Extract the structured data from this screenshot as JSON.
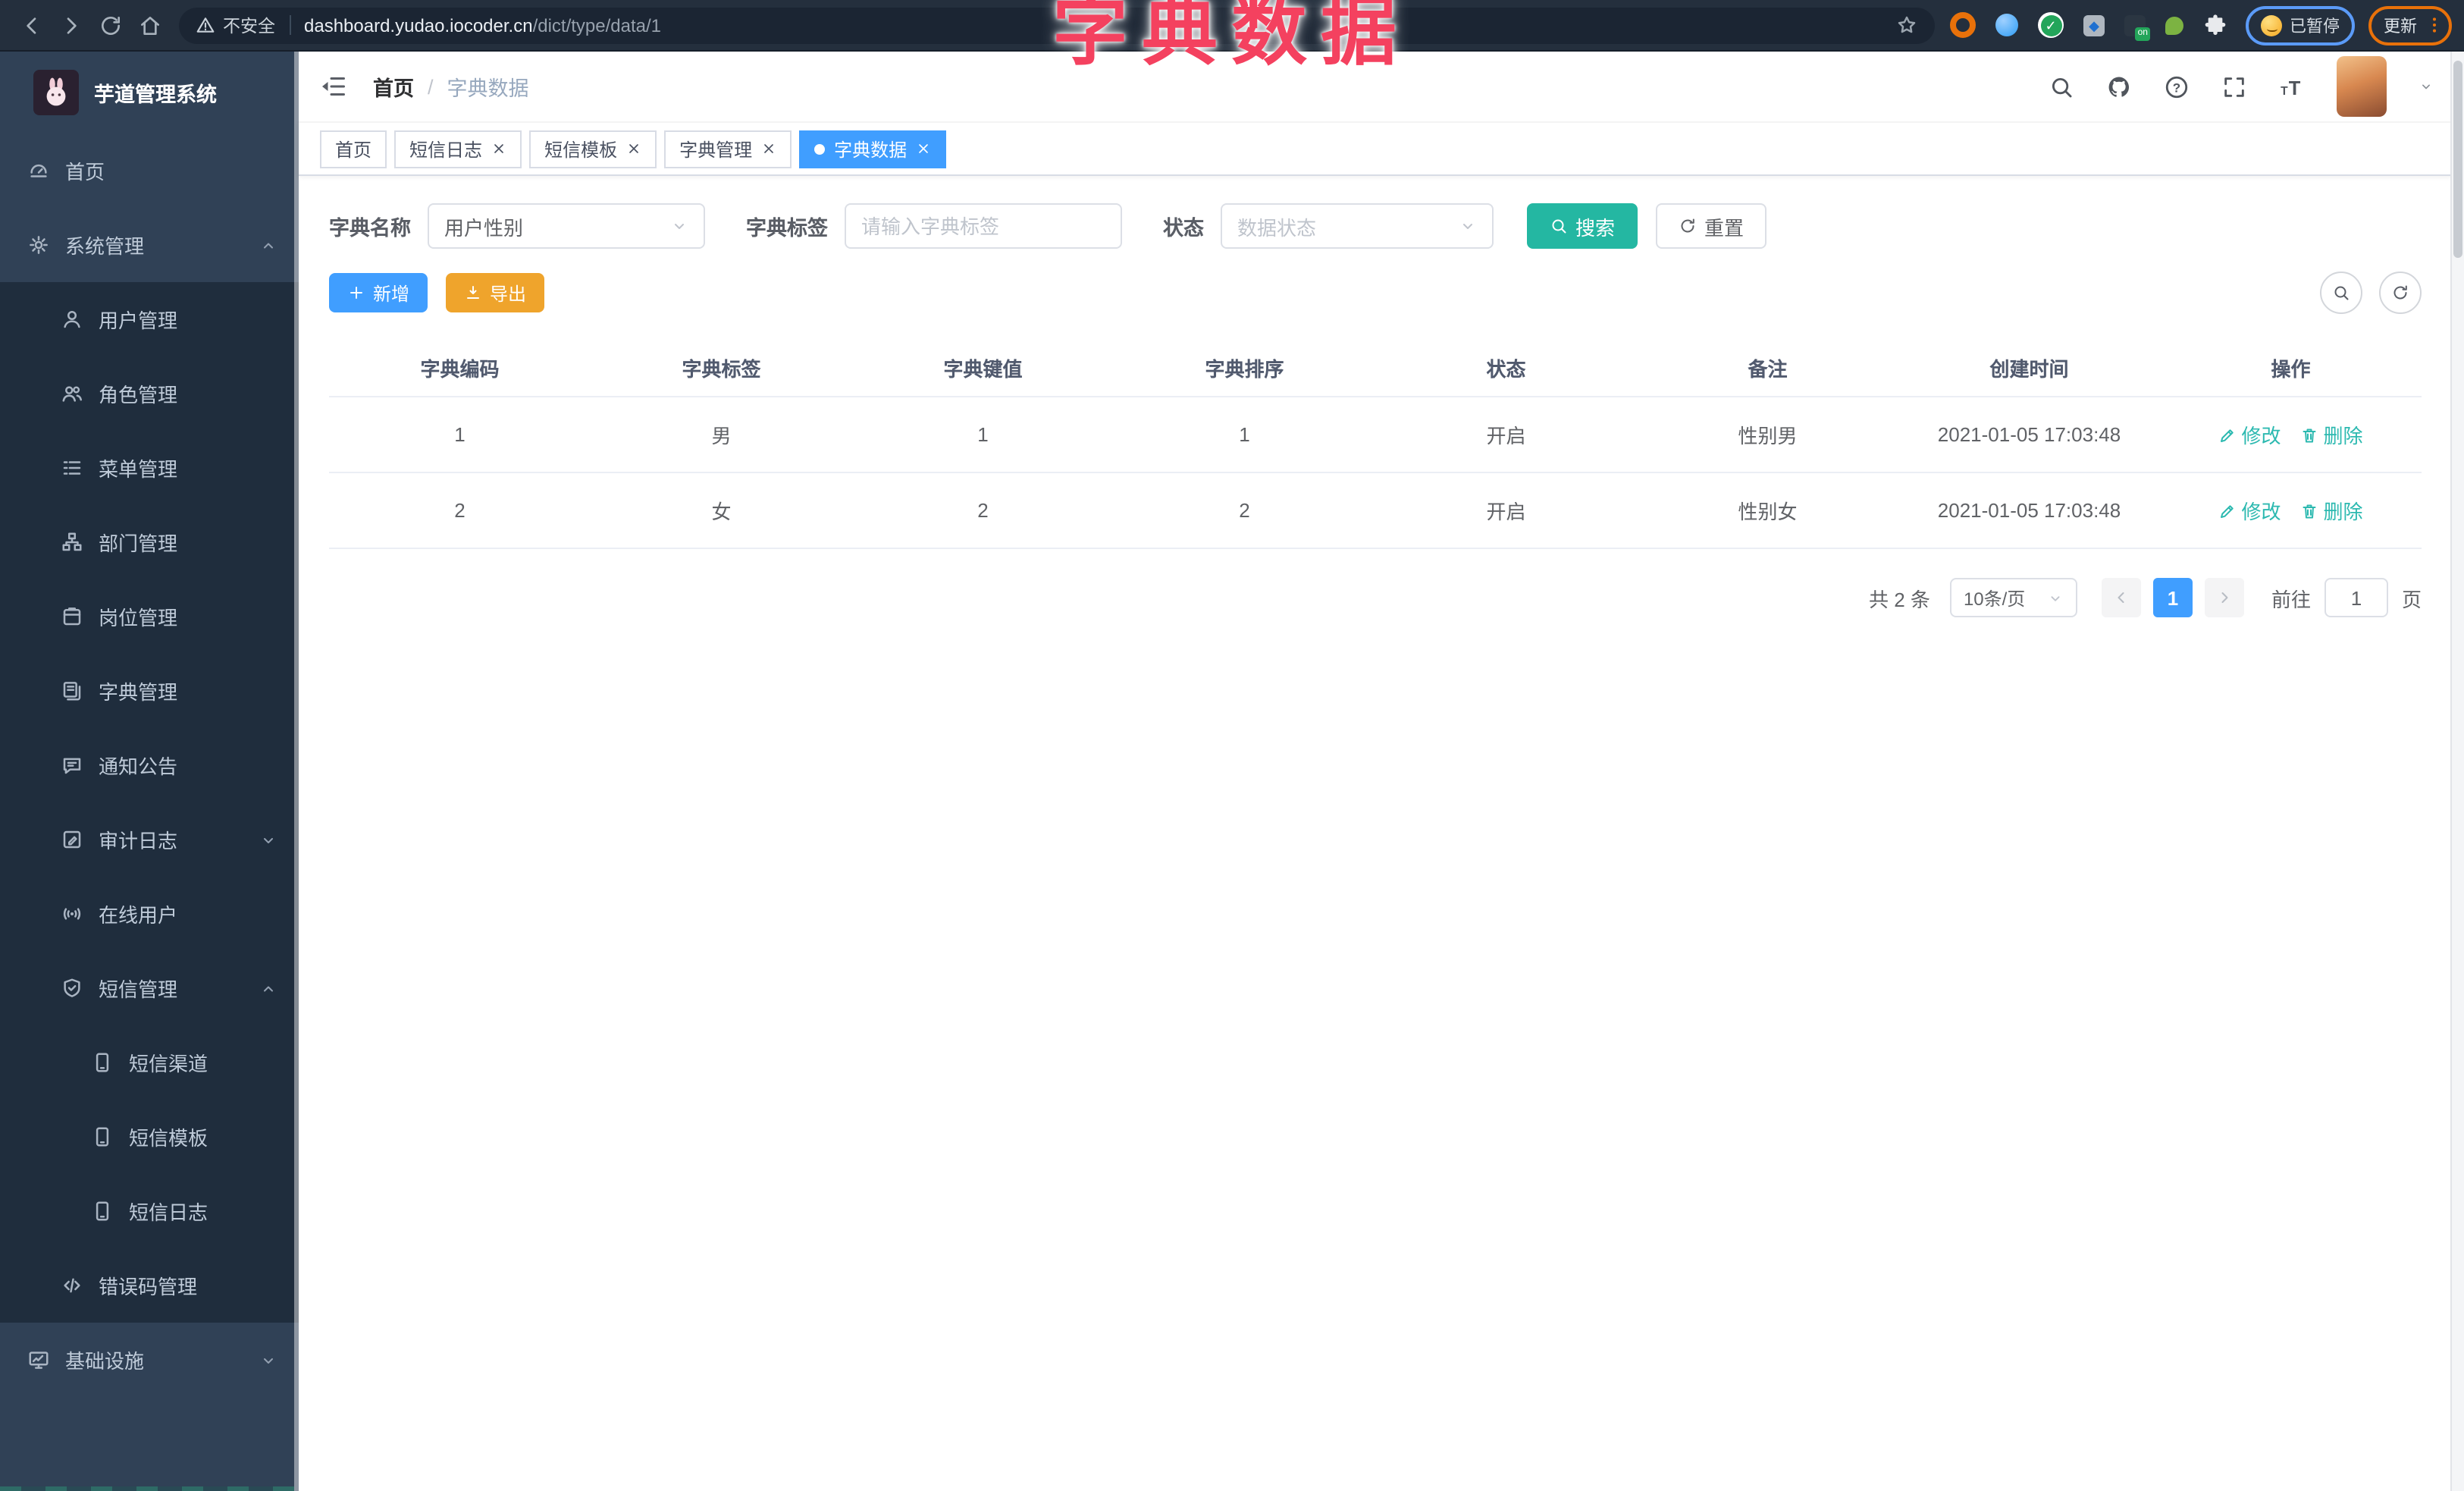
{
  "browser": {
    "security_label": "不安全",
    "url": "dashboard.yudao.iocoder.cn/dict/type/data/1",
    "paused_badge": "已暂停",
    "update_label": "更新"
  },
  "overlay": {
    "title": "字典数据"
  },
  "sidebar": {
    "title": "芋道管理系统",
    "items": [
      {
        "label": "首页",
        "icon": "dashboard-icon",
        "level": 1
      },
      {
        "label": "系统管理",
        "icon": "gear-icon",
        "level": 1,
        "caret": "up"
      },
      {
        "label": "用户管理",
        "icon": "user-icon",
        "level": 2
      },
      {
        "label": "角色管理",
        "icon": "users-icon",
        "level": 2
      },
      {
        "label": "菜单管理",
        "icon": "list-icon",
        "level": 2
      },
      {
        "label": "部门管理",
        "icon": "tree-icon",
        "level": 2
      },
      {
        "label": "岗位管理",
        "icon": "badge-icon",
        "level": 2
      },
      {
        "label": "字典管理",
        "icon": "book-icon",
        "level": 2
      },
      {
        "label": "通知公告",
        "icon": "megaphone-icon",
        "level": 2
      },
      {
        "label": "审计日志",
        "icon": "log-icon",
        "level": 2,
        "caret": "down"
      },
      {
        "label": "在线用户",
        "icon": "online-icon",
        "level": 2
      },
      {
        "label": "短信管理",
        "icon": "shield-icon",
        "level": 2,
        "caret": "up"
      },
      {
        "label": "短信渠道",
        "icon": "phone-icon",
        "level": 3
      },
      {
        "label": "短信模板",
        "icon": "phone-icon",
        "level": 3
      },
      {
        "label": "短信日志",
        "icon": "phone-icon",
        "level": 3
      },
      {
        "label": "错误码管理",
        "icon": "code-icon",
        "level": 2
      },
      {
        "label": "基础设施",
        "icon": "monitor-icon",
        "level": 1,
        "caret": "down"
      }
    ]
  },
  "navbar": {
    "breadcrumb": [
      "首页",
      "字典数据"
    ]
  },
  "tabs": [
    {
      "label": "首页",
      "closable": false,
      "active": false
    },
    {
      "label": "短信日志",
      "closable": true,
      "active": false
    },
    {
      "label": "短信模板",
      "closable": true,
      "active": false
    },
    {
      "label": "字典管理",
      "closable": true,
      "active": false
    },
    {
      "label": "字典数据",
      "closable": true,
      "active": true
    }
  ],
  "filters": {
    "name_label": "字典名称",
    "name_value": "用户性别",
    "tag_label": "字典标签",
    "tag_placeholder": "请输入字典标签",
    "status_label": "状态",
    "status_placeholder": "数据状态",
    "search_label": "搜索",
    "reset_label": "重置"
  },
  "toolbar": {
    "add_label": "新增",
    "export_label": "导出"
  },
  "table": {
    "headers": [
      "字典编码",
      "字典标签",
      "字典键值",
      "字典排序",
      "状态",
      "备注",
      "创建时间",
      "操作"
    ],
    "rows": [
      {
        "code": "1",
        "label": "男",
        "value": "1",
        "sort": "1",
        "status": "开启",
        "remark": "性别男",
        "created": "2021-01-05 17:03:48"
      },
      {
        "code": "2",
        "label": "女",
        "value": "2",
        "sort": "2",
        "status": "开启",
        "remark": "性别女",
        "created": "2021-01-05 17:03:48"
      }
    ],
    "edit_label": "修改",
    "delete_label": "删除"
  },
  "pagination": {
    "total": "共 2 条",
    "size": "10条/页",
    "page": "1",
    "goto": "前往",
    "unit": "页",
    "goto_value": "1"
  },
  "colors": {
    "primary": "#409eff",
    "search_button": "#24b7a2",
    "export_button": "#efa42c",
    "action_link": "#2cb9b0",
    "overlay_title": "#f4415f",
    "sidebar_bg": "#304156",
    "submenu_bg": "#1f2d3d",
    "chrome_bg": "#242f3d"
  }
}
